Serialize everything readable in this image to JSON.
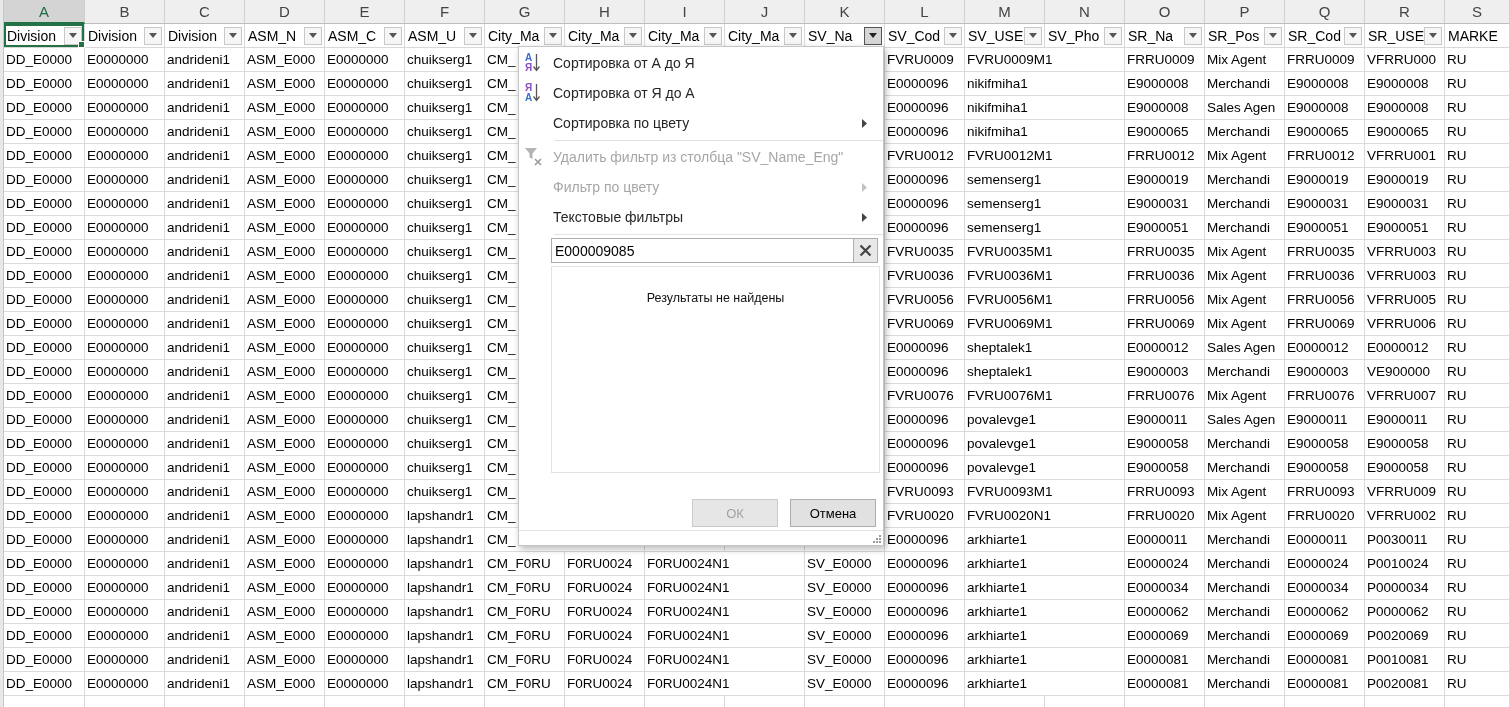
{
  "column_letters": [
    {
      "letter": "A",
      "selected": true
    },
    {
      "letter": "B",
      "selected": false
    },
    {
      "letter": "C",
      "selected": false
    },
    {
      "letter": "D",
      "selected": false
    },
    {
      "letter": "E",
      "selected": false
    },
    {
      "letter": "F",
      "selected": false
    },
    {
      "letter": "G",
      "selected": false
    },
    {
      "letter": "H",
      "selected": false
    },
    {
      "letter": "I",
      "selected": false
    },
    {
      "letter": "J",
      "selected": false
    },
    {
      "letter": "K",
      "selected": false
    },
    {
      "letter": "L",
      "selected": false
    },
    {
      "letter": "M",
      "selected": false
    },
    {
      "letter": "N",
      "selected": false
    },
    {
      "letter": "O",
      "selected": false
    },
    {
      "letter": "P",
      "selected": false
    },
    {
      "letter": "Q",
      "selected": false
    },
    {
      "letter": "R",
      "selected": false
    },
    {
      "letter": "S",
      "selected": false
    }
  ],
  "header_row": [
    {
      "label": "Division",
      "filter_button": true,
      "menu_open": false,
      "selected": true
    },
    {
      "label": "Division",
      "filter_button": true,
      "menu_open": false,
      "selected": false
    },
    {
      "label": "Division",
      "filter_button": true,
      "menu_open": false,
      "selected": false
    },
    {
      "label": "ASM_N",
      "filter_button": true,
      "menu_open": false,
      "selected": false
    },
    {
      "label": "ASM_C",
      "filter_button": true,
      "menu_open": false,
      "selected": false
    },
    {
      "label": "ASM_U",
      "filter_button": true,
      "menu_open": false,
      "selected": false
    },
    {
      "label": "City_Ma",
      "filter_button": true,
      "menu_open": false,
      "selected": false
    },
    {
      "label": "City_Ma",
      "filter_button": true,
      "menu_open": false,
      "selected": false
    },
    {
      "label": "City_Ma",
      "filter_button": true,
      "menu_open": false,
      "selected": false
    },
    {
      "label": "City_Ma",
      "filter_button": true,
      "menu_open": false,
      "selected": false
    },
    {
      "label": "SV_Na",
      "filter_button": true,
      "menu_open": true,
      "selected": false
    },
    {
      "label": "SV_Cod",
      "filter_button": true,
      "menu_open": false,
      "selected": false
    },
    {
      "label": "SV_USE",
      "filter_button": true,
      "menu_open": false,
      "selected": false
    },
    {
      "label": "SV_Pho",
      "filter_button": true,
      "menu_open": false,
      "selected": false
    },
    {
      "label": "SR_Na",
      "filter_button": true,
      "menu_open": false,
      "selected": false
    },
    {
      "label": "SR_Pos",
      "filter_button": true,
      "menu_open": false,
      "selected": false
    },
    {
      "label": "SR_Cod",
      "filter_button": true,
      "menu_open": false,
      "selected": false
    },
    {
      "label": "SR_USE",
      "filter_button": true,
      "menu_open": false,
      "selected": false
    },
    {
      "label": "MARKE",
      "filter_button": false,
      "selected": false
    }
  ],
  "rows": [
    [
      "DD_E0000",
      "E0000000",
      "andrideni1",
      "ASM_E000",
      "E0000000",
      "chuikserg1",
      "CM_",
      null,
      null,
      null,
      null,
      "FVRU0009",
      "FVRU0009M1",
      null,
      "FRRU0009",
      "Mix Agent",
      "FRRU0009",
      "VFRRU000",
      "RU"
    ],
    [
      "DD_E0000",
      "E0000000",
      "andrideni1",
      "ASM_E000",
      "E0000000",
      "chuikserg1",
      "CM_",
      null,
      null,
      null,
      null,
      "E0000096",
      "nikifmiha1",
      null,
      "E9000008",
      "Merchandi",
      "E9000008",
      "E9000008",
      "RU"
    ],
    [
      "DD_E0000",
      "E0000000",
      "andrideni1",
      "ASM_E000",
      "E0000000",
      "chuikserg1",
      "CM_",
      null,
      null,
      null,
      null,
      "E0000096",
      "nikifmiha1",
      null,
      "E9000008",
      "Sales Agen",
      "E9000008",
      "E9000008",
      "RU"
    ],
    [
      "DD_E0000",
      "E0000000",
      "andrideni1",
      "ASM_E000",
      "E0000000",
      "chuikserg1",
      "CM_",
      null,
      null,
      null,
      null,
      "E0000096",
      "nikifmiha1",
      null,
      "E9000065",
      "Merchandi",
      "E9000065",
      "E9000065",
      "RU"
    ],
    [
      "DD_E0000",
      "E0000000",
      "andrideni1",
      "ASM_E000",
      "E0000000",
      "chuikserg1",
      "CM_",
      null,
      null,
      null,
      null,
      "FVRU0012",
      "FVRU0012M1",
      null,
      "FRRU0012",
      "Mix Agent",
      "FRRU0012",
      "VFRRU001",
      "RU"
    ],
    [
      "DD_E0000",
      "E0000000",
      "andrideni1",
      "ASM_E000",
      "E0000000",
      "chuikserg1",
      "CM_",
      null,
      null,
      null,
      null,
      "E0000096",
      "semenserg1",
      null,
      "E9000019",
      "Merchandi",
      "E9000019",
      "E9000019",
      "RU"
    ],
    [
      "DD_E0000",
      "E0000000",
      "andrideni1",
      "ASM_E000",
      "E0000000",
      "chuikserg1",
      "CM_",
      null,
      null,
      null,
      null,
      "E0000096",
      "semenserg1",
      null,
      "E9000031",
      "Merchandi",
      "E9000031",
      "E9000031",
      "RU"
    ],
    [
      "DD_E0000",
      "E0000000",
      "andrideni1",
      "ASM_E000",
      "E0000000",
      "chuikserg1",
      "CM_",
      null,
      null,
      null,
      null,
      "E0000096",
      "semenserg1",
      null,
      "E9000051",
      "Merchandi",
      "E9000051",
      "E9000051",
      "RU"
    ],
    [
      "DD_E0000",
      "E0000000",
      "andrideni1",
      "ASM_E000",
      "E0000000",
      "chuikserg1",
      "CM_",
      null,
      null,
      null,
      null,
      "FVRU0035",
      "FVRU0035M1",
      null,
      "FRRU0035",
      "Mix Agent",
      "FRRU0035",
      "VFRRU003",
      "RU"
    ],
    [
      "DD_E0000",
      "E0000000",
      "andrideni1",
      "ASM_E000",
      "E0000000",
      "chuikserg1",
      "CM_",
      null,
      null,
      null,
      null,
      "FVRU0036",
      "FVRU0036M1",
      null,
      "FRRU0036",
      "Mix Agent",
      "FRRU0036",
      "VFRRU003",
      "RU"
    ],
    [
      "DD_E0000",
      "E0000000",
      "andrideni1",
      "ASM_E000",
      "E0000000",
      "chuikserg1",
      "CM_",
      null,
      null,
      null,
      null,
      "FVRU0056",
      "FVRU0056M1",
      null,
      "FRRU0056",
      "Mix Agent",
      "FRRU0056",
      "VFRRU005",
      "RU"
    ],
    [
      "DD_E0000",
      "E0000000",
      "andrideni1",
      "ASM_E000",
      "E0000000",
      "chuikserg1",
      "CM_",
      null,
      null,
      null,
      null,
      "FVRU0069",
      "FVRU0069M1",
      null,
      "FRRU0069",
      "Mix Agent",
      "FRRU0069",
      "VFRRU006",
      "RU"
    ],
    [
      "DD_E0000",
      "E0000000",
      "andrideni1",
      "ASM_E000",
      "E0000000",
      "chuikserg1",
      "CM_",
      null,
      null,
      null,
      null,
      "E0000096",
      "sheptalek1",
      null,
      "E0000012",
      "Sales Agen",
      "E0000012",
      "E0000012",
      "RU"
    ],
    [
      "DD_E0000",
      "E0000000",
      "andrideni1",
      "ASM_E000",
      "E0000000",
      "chuikserg1",
      "CM_",
      null,
      null,
      null,
      null,
      "E0000096",
      "sheptalek1",
      null,
      "E9000003",
      "Merchandi",
      "E9000003",
      "VE900000",
      "RU"
    ],
    [
      "DD_E0000",
      "E0000000",
      "andrideni1",
      "ASM_E000",
      "E0000000",
      "chuikserg1",
      "CM_",
      null,
      null,
      null,
      null,
      "FVRU0076",
      "FVRU0076M1",
      null,
      "FRRU0076",
      "Mix Agent",
      "FRRU0076",
      "VFRRU007",
      "RU"
    ],
    [
      "DD_E0000",
      "E0000000",
      "andrideni1",
      "ASM_E000",
      "E0000000",
      "chuikserg1",
      "CM_",
      null,
      null,
      null,
      null,
      "E0000096",
      "povalevge1",
      null,
      "E9000011",
      "Sales Agen",
      "E9000011",
      "E9000011",
      "RU"
    ],
    [
      "DD_E0000",
      "E0000000",
      "andrideni1",
      "ASM_E000",
      "E0000000",
      "chuikserg1",
      "CM_",
      null,
      null,
      null,
      null,
      "E0000096",
      "povalevge1",
      null,
      "E9000058",
      "Merchandi",
      "E9000058",
      "E9000058",
      "RU"
    ],
    [
      "DD_E0000",
      "E0000000",
      "andrideni1",
      "ASM_E000",
      "E0000000",
      "chuikserg1",
      "CM_",
      null,
      null,
      null,
      null,
      "E0000096",
      "povalevge1",
      null,
      "E9000058",
      "Merchandi",
      "E9000058",
      "E9000058",
      "RU"
    ],
    [
      "DD_E0000",
      "E0000000",
      "andrideni1",
      "ASM_E000",
      "E0000000",
      "chuikserg1",
      "CM_",
      null,
      null,
      null,
      null,
      "FVRU0093",
      "FVRU0093M1",
      null,
      "FRRU0093",
      "Mix Agent",
      "FRRU0093",
      "VFRRU009",
      "RU"
    ],
    [
      "DD_E0000",
      "E0000000",
      "andrideni1",
      "ASM_E000",
      "E0000000",
      "lapshandr1",
      "CM_",
      null,
      null,
      null,
      null,
      "FVRU0020",
      "FVRU0020N1",
      null,
      "FRRU0020",
      "Mix Agent",
      "FRRU0020",
      "VFRRU002",
      "RU"
    ],
    [
      "DD_E0000",
      "E0000000",
      "andrideni1",
      "ASM_E000",
      "E0000000",
      "lapshandr1",
      "CM_",
      null,
      null,
      null,
      null,
      "E0000096",
      "arkhiarte1",
      null,
      "E0000011",
      "Merchandi",
      "E0000011",
      "P0030011",
      "RU"
    ],
    [
      "DD_E0000",
      "E0000000",
      "andrideni1",
      "ASM_E000",
      "E0000000",
      "lapshandr1",
      "CM_F0RU",
      "F0RU0024",
      "F0RU0024N1",
      null,
      "SV_E0000",
      "E0000096",
      "arkhiarte1",
      null,
      "E0000024",
      "Merchandi",
      "E0000024",
      "P0010024",
      "RU"
    ],
    [
      "DD_E0000",
      "E0000000",
      "andrideni1",
      "ASM_E000",
      "E0000000",
      "lapshandr1",
      "CM_F0RU",
      "F0RU0024",
      "F0RU0024N1",
      null,
      "SV_E0000",
      "E0000096",
      "arkhiarte1",
      null,
      "E0000034",
      "Merchandi",
      "E0000034",
      "P0000034",
      "RU"
    ],
    [
      "DD_E0000",
      "E0000000",
      "andrideni1",
      "ASM_E000",
      "E0000000",
      "lapshandr1",
      "CM_F0RU",
      "F0RU0024",
      "F0RU0024N1",
      null,
      "SV_E0000",
      "E0000096",
      "arkhiarte1",
      null,
      "E0000062",
      "Merchandi",
      "E0000062",
      "P0000062",
      "RU"
    ],
    [
      "DD_E0000",
      "E0000000",
      "andrideni1",
      "ASM_E000",
      "E0000000",
      "lapshandr1",
      "CM_F0RU",
      "F0RU0024",
      "F0RU0024N1",
      null,
      "SV_E0000",
      "E0000096",
      "arkhiarte1",
      null,
      "E0000069",
      "Merchandi",
      "E0000069",
      "P0020069",
      "RU"
    ],
    [
      "DD_E0000",
      "E0000000",
      "andrideni1",
      "ASM_E000",
      "E0000000",
      "lapshandr1",
      "CM_F0RU",
      "F0RU0024",
      "F0RU0024N1",
      null,
      "SV_E0000",
      "E0000096",
      "arkhiarte1",
      null,
      "E0000081",
      "Merchandi",
      "E0000081",
      "P0010081",
      "RU"
    ],
    [
      "DD_E0000",
      "E0000000",
      "andrideni1",
      "ASM_E000",
      "E0000000",
      "lapshandr1",
      "CM_F0RU",
      "F0RU0024",
      "F0RU0024N1",
      null,
      "SV_E0000",
      "E0000096",
      "arkhiarte1",
      null,
      "E0000081",
      "Merchandi",
      "E0000081",
      "P0020081",
      "RU"
    ]
  ],
  "filter_menu": {
    "groups": [
      {
        "items": [
          {
            "kind": "sort_asc",
            "icon_letters": [
              "А",
              "Я"
            ],
            "label": "Сортировка от А до Я",
            "disabled": false,
            "submenu": false
          },
          {
            "kind": "sort_desc",
            "icon_letters": [
              "Я",
              "А"
            ],
            "label": "Сортировка от Я до А",
            "disabled": false,
            "submenu": false
          },
          {
            "kind": "plain",
            "label": "Сортировка по цвету",
            "disabled": false,
            "submenu": true
          }
        ]
      },
      {
        "items": [
          {
            "kind": "clear_filter",
            "label": "Удалить фильтр из столбца \"SV_Name_Eng\"",
            "disabled": true,
            "submenu": false
          },
          {
            "kind": "plain",
            "label": "Фильтр по цвету",
            "disabled": true,
            "submenu": true
          },
          {
            "kind": "plain",
            "label": "Текстовые фильтры",
            "disabled": false,
            "submenu": true
          }
        ]
      }
    ],
    "search": {
      "value": "E000009085"
    },
    "results_message": "Результаты не найдены",
    "buttons": [
      {
        "label": "ОК",
        "disabled": true
      },
      {
        "label": "Отмена",
        "disabled": false
      }
    ]
  }
}
